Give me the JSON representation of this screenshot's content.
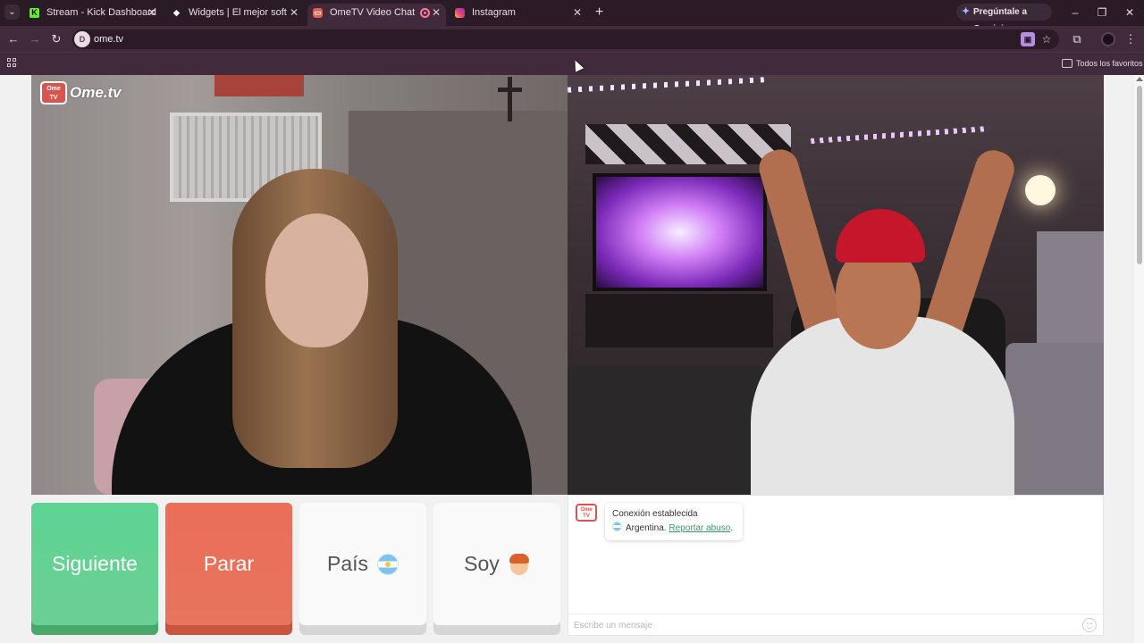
{
  "browser": {
    "tabs": [
      {
        "title": "Stream - Kick Dashboard",
        "active": false
      },
      {
        "title": "Widgets | El mejor software para",
        "active": false
      },
      {
        "title": "OmeTV Video Chat — Ome",
        "active": true
      },
      {
        "title": "Instagram",
        "active": false
      }
    ],
    "gemini_label": "Pregúntale a Gemini",
    "url": "ome.tv",
    "bookmarks_label": "Todos los favoritos"
  },
  "page": {
    "logo_text": "Ome.tv",
    "logo_badge": "Ome TV",
    "controls": {
      "next_label": "Siguiente",
      "stop_label": "Parar",
      "country_label": "País",
      "gender_label": "Soy"
    },
    "chat": {
      "status": "Conexión establecida",
      "country": "Argentina.",
      "report_link": "Reportar abuso",
      "report_suffix": ".",
      "message_placeholder": "Escribe un mensaje"
    }
  },
  "colors": {
    "next": "#5dd493",
    "stop": "#ea6e58",
    "browser_frame": "#402a3b"
  }
}
